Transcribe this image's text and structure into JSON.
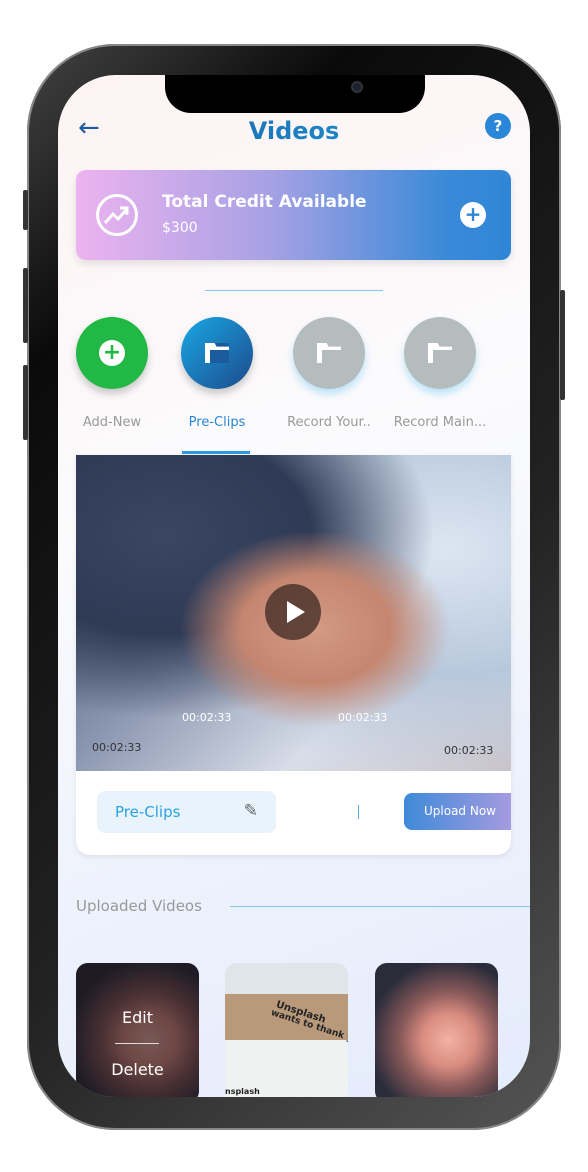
{
  "header": {
    "title": "Videos",
    "back_icon": "arrow-left-icon",
    "help_icon": "question-icon"
  },
  "credit": {
    "title": "Total Credit Available",
    "amount": "$300",
    "icon": "trending-up-icon",
    "add_icon": "plus-circle-icon"
  },
  "categories": [
    {
      "label": "Add-New",
      "icon": "plus-circle-icon",
      "color": "#22b845"
    },
    {
      "label": "Pre-Clips",
      "icon": "folder-icon",
      "color": "#1a7cc4",
      "active": true
    },
    {
      "label": "Record Your..",
      "icon": "folder-icon",
      "color": "#b5bcbe"
    },
    {
      "label": "Record Main...",
      "icon": "folder-icon",
      "color": "#b5bcbe"
    }
  ],
  "video": {
    "timestamps": [
      "00:02:33",
      "00:02:33",
      "00:02:33",
      "00:02:33"
    ],
    "name": "Pre-Clips",
    "upload_label": "Upload Now"
  },
  "uploaded": {
    "title": "Uploaded Videos",
    "edit_label": "Edit",
    "delete_label": "Delete",
    "thumb_text": [
      "Unsplash",
      "wants to thank y",
      "nsplash"
    ]
  },
  "colors": {
    "accent": "#2a86d8",
    "green": "#22b845"
  }
}
